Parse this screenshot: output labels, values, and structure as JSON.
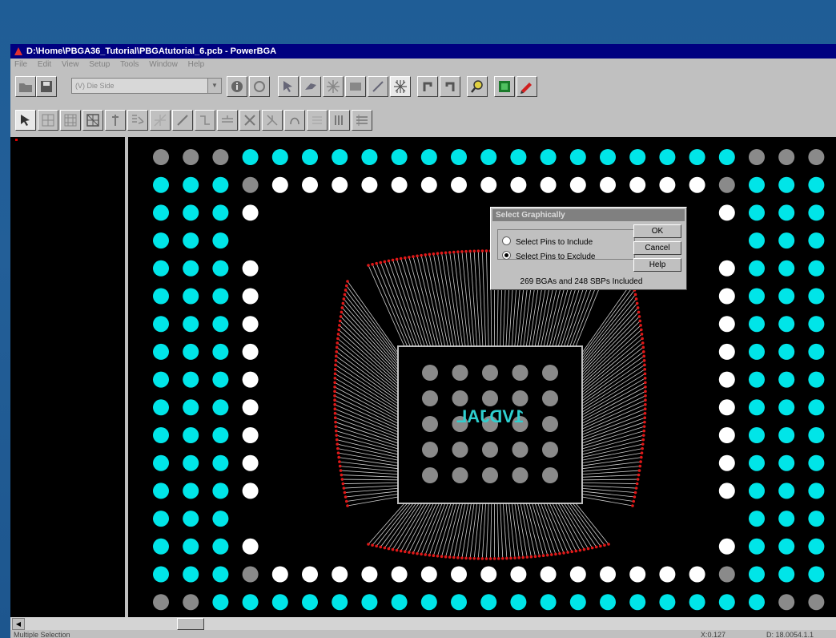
{
  "window": {
    "title": "D:\\Home\\PBGA36_Tutorial\\PBGAtutorial_6.pcb - PowerBGA"
  },
  "menubar": {
    "items": [
      "File",
      "Edit",
      "View",
      "Setup",
      "Tools",
      "Window",
      "Help"
    ]
  },
  "toolbar1": {
    "layer_select": "(V) Die Side",
    "icons": [
      "open-folder-icon",
      "save-icon",
      "info-icon",
      "refresh-icon",
      "select-arrow-icon",
      "route-icon",
      "star-pattern-icon",
      "rectangle-icon",
      "diagonal-line-icon",
      "snowflake-icon",
      "undo-icon",
      "redo-icon",
      "zoom-icon",
      "board-view-icon",
      "pen-tool-icon"
    ]
  },
  "toolbar2": {
    "icons": [
      "pointer-icon",
      "grid-pad-icon",
      "bga-array-icon",
      "matrix-icon",
      "pin-icon",
      "fan-icon",
      "spread-icon",
      "line-icon",
      "net-icon",
      "bus-icon",
      "cross-icon",
      "split-icon",
      "wirebond-icon",
      "parallel-icon",
      "vertical-bars-icon",
      "layers-icon"
    ]
  },
  "canvas": {
    "component_label": "1VDJAL",
    "colors": {
      "ball_signal": "#00e5e8",
      "ball_power": "#ffffff",
      "ball_inactive": "#8a8a8a",
      "wire": "#d0d0d0",
      "finger": "#e01818",
      "label": "#2ecfcf"
    }
  },
  "dialog": {
    "title": "Select Graphically",
    "option_include": "Select Pins to Include",
    "option_exclude": "Select Pins to Exclude",
    "selected_option": "exclude",
    "ok": "OK",
    "cancel": "Cancel",
    "help": "Help",
    "status": "269 BGAs and 248 SBPs Included"
  },
  "statusbar": {
    "mode": "Multiple   Selection",
    "coord1": "X:0.127",
    "coord2": "D: 18.0054.1.1"
  }
}
